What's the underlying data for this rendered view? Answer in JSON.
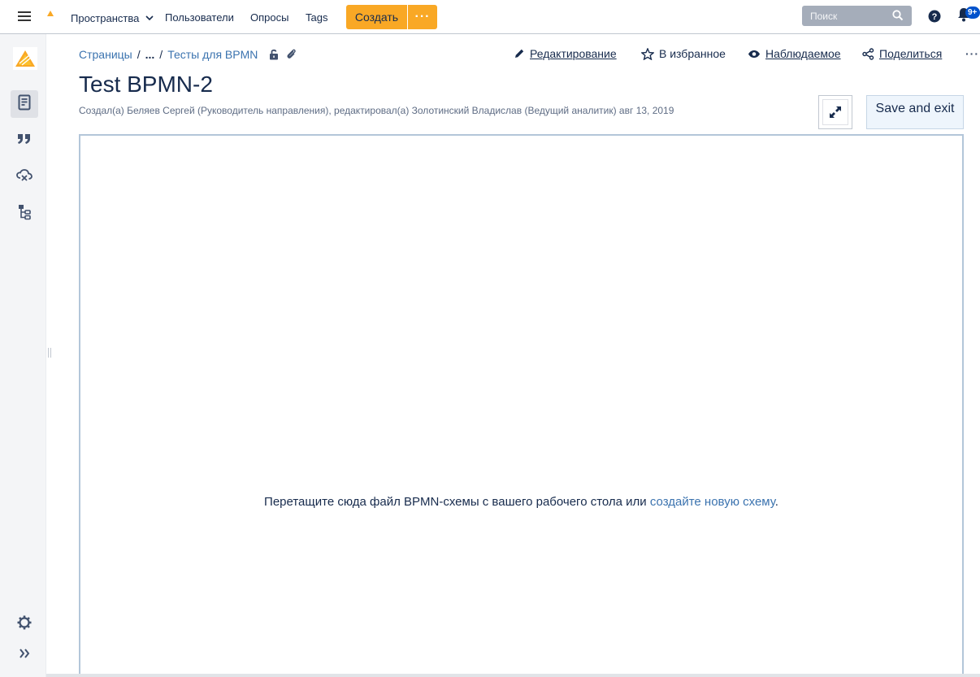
{
  "topnav": {
    "spaces": "Пространства",
    "users": "Пользователи",
    "polls": "Опросы",
    "tags": "Tags",
    "create": "Создать",
    "search_placeholder": "Поиск",
    "notification_count": "9+"
  },
  "colors": {
    "accent": "#f9a825",
    "link": "#3b73af",
    "text": "#172b4d"
  },
  "sidebar": {
    "items": [
      {
        "icon": "page-icon",
        "active": true
      },
      {
        "icon": "quote-icon",
        "active": false
      },
      {
        "icon": "cloud-link-icon",
        "active": false
      },
      {
        "icon": "page-tree-icon",
        "active": false
      }
    ],
    "bottom": [
      "gear-icon",
      "chevrons-right-icon"
    ]
  },
  "breadcrumb": {
    "root": "Страницы",
    "ellipsis": "...",
    "parent": "Тесты для BPMN"
  },
  "actions": {
    "edit": "Редактирование",
    "favorite": "В избранное",
    "watch": "Наблюдаемое",
    "share": "Поделиться"
  },
  "page": {
    "title": "Test BPMN-2",
    "byline": "Создал(а) Беляев Сергей (Руководитель направления), редактировал(а) Золотинский Владислав (Ведущий аналитик) авг 13, 2019"
  },
  "editor": {
    "save_exit": "Save and exit",
    "drop_text": "Перетащите сюда файл BPMN-схемы с вашего рабочего стола или ",
    "create_link": "создайте новую схему",
    "drop_tail": "."
  }
}
